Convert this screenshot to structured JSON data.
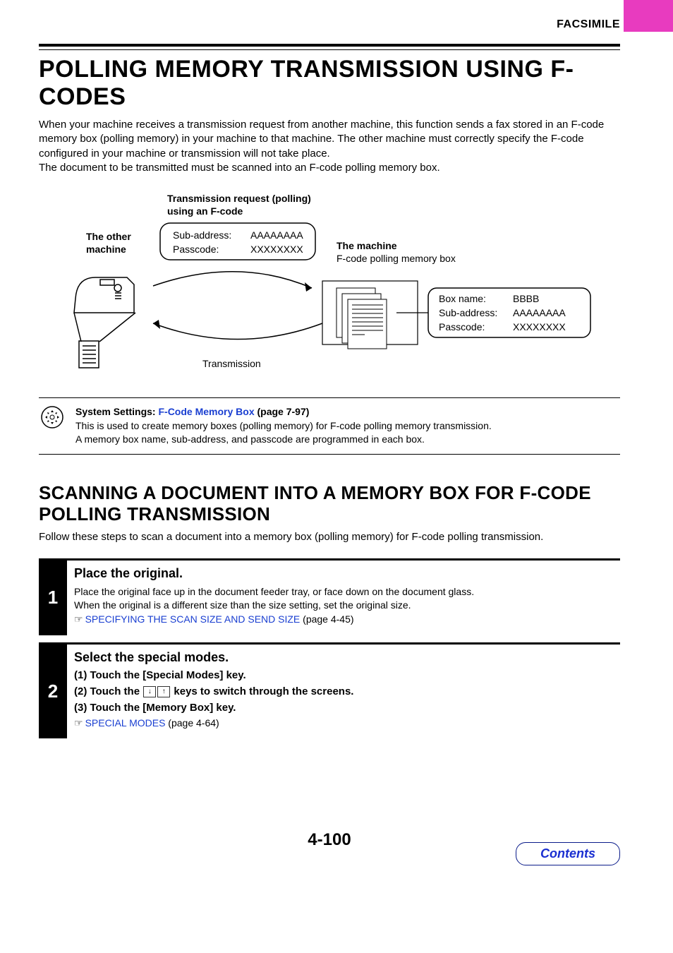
{
  "header": {
    "section": "FACSIMILE"
  },
  "h1": "POLLING MEMORY TRANSMISSION USING F-CODES",
  "intro": "When your machine receives a transmission request from another machine, this function sends a fax stored in an F-code memory box (polling memory) in your machine to that machine. The other machine must correctly specify the F-code configured in your machine or transmission will not take place.\nThe document to be transmitted must be scanned into an F-code polling memory box.",
  "diagram": {
    "request_title_l1": "Transmission request (polling)",
    "request_title_l2": "using an F-code",
    "other_machine_l1": "The other",
    "other_machine_l2": "machine",
    "request_box": {
      "sub_lbl": "Sub-address:",
      "sub_val": "AAAAAAAA",
      "pass_lbl": "Passcode:",
      "pass_val": "XXXXXXXX"
    },
    "machine_l1": "The machine",
    "machine_l2": "F-code polling memory box",
    "memory_box": {
      "name_lbl": "Box name:",
      "name_val": "BBBB",
      "sub_lbl": "Sub-address:",
      "sub_val": "AAAAAAAA",
      "pass_lbl": "Passcode:",
      "pass_val": "XXXXXXXX"
    },
    "transmission_label": "Transmission"
  },
  "callout": {
    "prefix": "System Settings: ",
    "link": "F-Code Memory Box",
    "page_ref": " (page 7-97)",
    "body_l1": "This is used to create memory boxes (polling memory) for F-code polling memory transmission.",
    "body_l2": "A memory box name, sub-address, and passcode are programmed in each box."
  },
  "h2": "SCANNING A DOCUMENT INTO A MEMORY BOX FOR F-CODE POLLING TRANSMISSION",
  "h2_intro": "Follow these steps to scan a document into a memory box (polling memory) for F-code polling transmission.",
  "steps": [
    {
      "num": "1",
      "title": "Place the original.",
      "body_l1": "Place the original face up in the document feeder tray, or face down on the document glass.",
      "body_l2": "When the original is a different size than the size setting, set the original size.",
      "ref_link": "SPECIFYING THE SCAN SIZE AND SEND SIZE",
      "ref_page": " (page 4-45)"
    },
    {
      "num": "2",
      "title": "Select the special modes.",
      "sub1": "(1)  Touch the [Special Modes] key.",
      "sub2_a": "(2)  Touch the ",
      "sub2_b": " keys to switch through the screens.",
      "sub3": "(3)  Touch the [Memory Box] key.",
      "ref_link": "SPECIAL MODES",
      "ref_page": " (page 4-64)"
    }
  ],
  "page_number": "4-100",
  "contents_btn": "Contents"
}
